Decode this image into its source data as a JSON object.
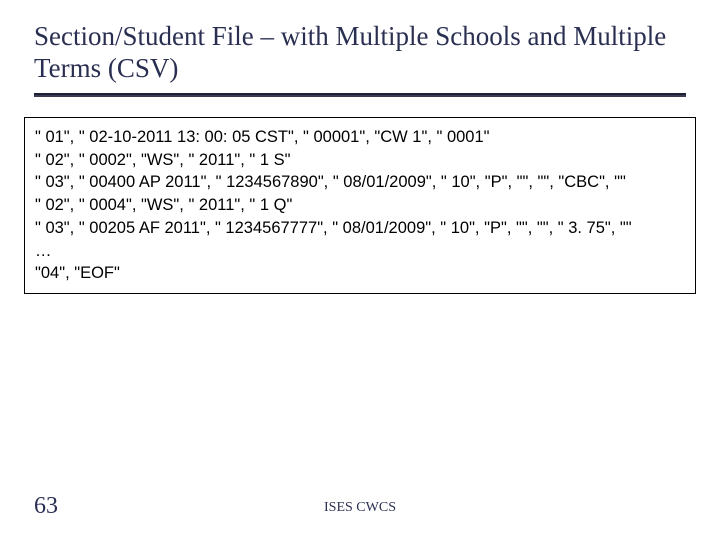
{
  "title": "Section/Student File – with Multiple Schools and Multiple Terms (CSV)",
  "csv_lines": [
    "\" 01\", \" 02-10-2011 13: 00: 05 CST\", \" 00001\", \"CW 1\", \" 0001\"",
    "\" 02\", \" 0002\", \"WS\", \" 2011\", \" 1 S\"",
    "\" 03\", \" 00400 AP 2011\", \" 1234567890\", \" 08/01/2009\", \" 10\", \"P\", \"\", \"\", \"CBC\", \"\"",
    "\" 02\", \" 0004\", \"WS\", \" 2011\", \" 1 Q\"",
    "\" 03\", \" 00205 AF 2011\", \" 1234567777\", \" 08/01/2009\", \" 10\", \"P\", \"\", \"\", \" 3. 75\", \"\"",
    "…",
    "\"04\", \"EOF\""
  ],
  "footer": {
    "page_number": "63",
    "label": "ISES CWCS"
  }
}
